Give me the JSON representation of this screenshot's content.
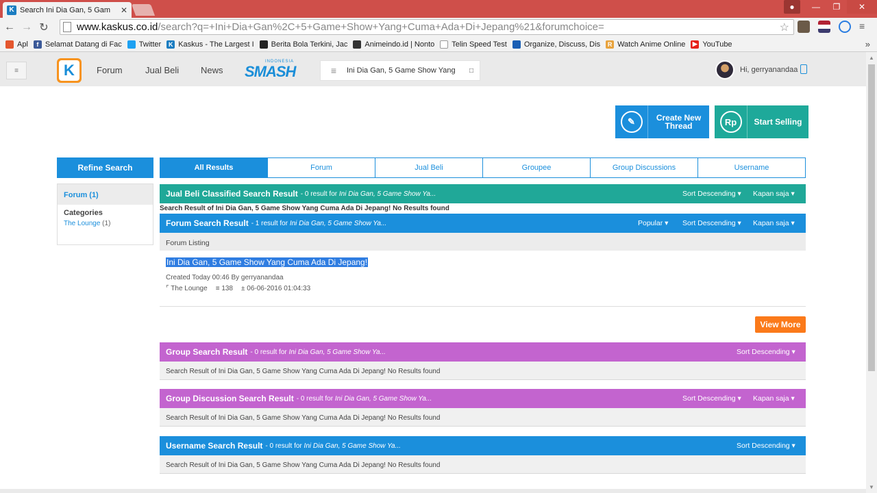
{
  "browser": {
    "tab_title": "Search Ini Dia Gan, 5 Gam",
    "tab_favicon": "K",
    "tab_close": "✕",
    "url_host": "www.kaskus.co.id",
    "url_rest": "/search?q=+Ini+Dia+Gan%2C+5+Game+Show+Yang+Cuma+Ada+Di+Jepang%21&forumchoice=",
    "bookmarks": [
      {
        "label": "Apl",
        "icon": "apps-icon",
        "color": "#e4572e"
      },
      {
        "label": "Selamat Datang di Fac",
        "icon": "facebook-icon",
        "color": "#3b5998"
      },
      {
        "label": "Twitter",
        "icon": "twitter-icon",
        "color": "#1da1f2"
      },
      {
        "label": "Kaskus - The Largest I",
        "icon": "kaskus-icon",
        "color": "#1b7dc1"
      },
      {
        "label": "Berita Bola Terkini, Jac",
        "icon": "news-icon",
        "color": "#222222"
      },
      {
        "label": "Animeindo.id | Nonto",
        "icon": "tv-icon",
        "color": "#333333"
      },
      {
        "label": "Telin Speed Test",
        "icon": "page-icon",
        "color": "#999999"
      },
      {
        "label": "Organize, Discuss, Dis",
        "icon": "organize-icon",
        "color": "#1a5fb4"
      },
      {
        "label": "Watch Anime Online",
        "icon": "anime-icon",
        "color": "#e8a33d"
      },
      {
        "label": "YouTube",
        "icon": "youtube-icon",
        "color": "#e62117"
      }
    ],
    "bookmarks_more": "»"
  },
  "site": {
    "nav": {
      "forum": "Forum",
      "jual_beli": "Jual Beli",
      "news": "News",
      "smash_small": "INDONESIA",
      "smash_big": "SMASH",
      "search_value": "Ini Dia Gan, 5 Game Show Yang",
      "greeting": "Hi, gerryanandaa"
    },
    "cta": {
      "create_thread": "Create New Thread",
      "start_selling": "Start Selling",
      "rp_icon": "Rp"
    },
    "refine": {
      "title": "Refine Search",
      "active": "Forum (1)",
      "categories_label": "Categories",
      "category_item": "The Lounge",
      "category_count": "(1)"
    },
    "tabs": [
      "All Results",
      "Forum",
      "Jual Beli",
      "Groupee",
      "Group Discussions",
      "Username"
    ],
    "jual_beli": {
      "title": "Jual Beli Classified Search Result",
      "meta_prefix": "- 0 result for",
      "query": "Ini Dia Gan, 5 Game Show Ya...",
      "sort": "Sort Descending",
      "time": "Kapan saja",
      "note": "Search Result of Ini Dia Gan, 5 Game Show Yang Cuma Ada Di Jepang! No Results found"
    },
    "forum": {
      "title": "Forum Search Result",
      "meta_prefix": "- 1 result for",
      "query": "Ini Dia Gan, 5 Game Show Ya...",
      "popular": "Popular",
      "sort": "Sort Descending",
      "time": "Kapan saja",
      "listing": "Forum Listing",
      "result_title": "Ini Dia Gan, 5 Game Show Yang Cuma Ada Di Jepang!",
      "result_meta": "Created Today 00:46 By gerryanandaa",
      "result_category": "The Lounge",
      "result_views": "138",
      "result_date": "06-06-2016 01:04:33",
      "view_more": "View More"
    },
    "group": {
      "title": "Group Search Result",
      "meta_prefix": "- 0 result for",
      "query": "Ini Dia Gan, 5 Game Show Ya...",
      "sort": "Sort Descending",
      "note": "Search Result of Ini Dia Gan, 5 Game Show Yang Cuma Ada Di Jepang! No Results found"
    },
    "group_discussion": {
      "title": "Group Discussion Search Result",
      "meta_prefix": "- 0 result for",
      "query": "Ini Dia Gan, 5 Game Show Ya...",
      "sort": "Sort Descending",
      "time": "Kapan saja",
      "note": "Search Result of Ini Dia Gan, 5 Game Show Yang Cuma Ada Di Jepang! No Results found"
    },
    "username": {
      "title": "Username Search Result",
      "meta_prefix": "- 0 result for",
      "query": "Ini Dia Gan, 5 Game Show Ya...",
      "sort": "Sort Descending",
      "note": "Search Result of Ini Dia Gan, 5 Game Show Yang Cuma Ada Di Jepang! No Results found"
    }
  }
}
